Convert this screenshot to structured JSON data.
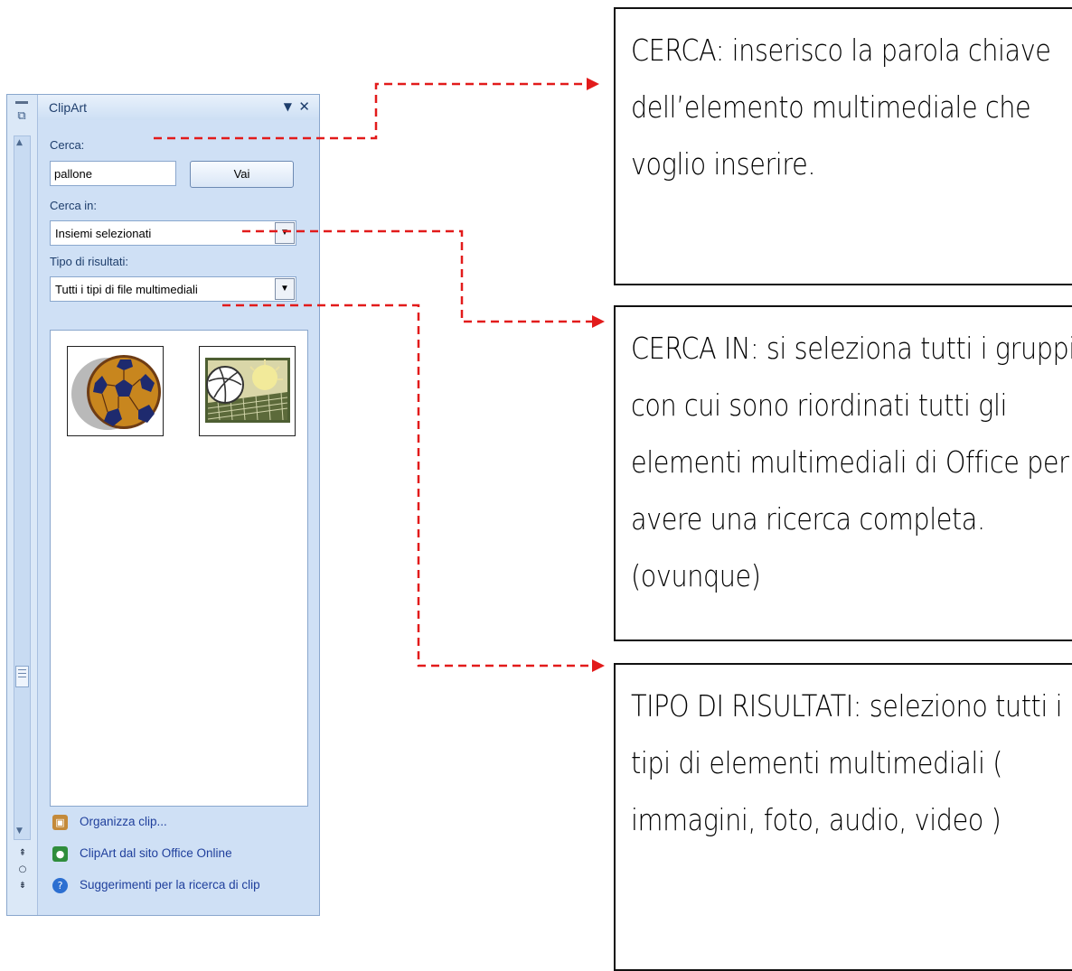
{
  "pane": {
    "title": "ClipArt",
    "search_label": "Cerca:",
    "search_value": "pallone",
    "go_button": "Vai",
    "search_in_label": "Cerca in:",
    "search_in_value": "Insiemi selezionati",
    "result_type_label": "Tipo di risultati:",
    "result_type_value": "Tutti i tipi di file multimediali",
    "results": [
      {
        "icon": "soccer-ball-clipart"
      },
      {
        "icon": "volleyball-net-clipart"
      }
    ],
    "links": [
      {
        "label": "Organizza clip...",
        "icon": "organize-clips-icon"
      },
      {
        "label": "ClipArt dal sito Office Online",
        "icon": "office-online-icon"
      },
      {
        "label": "Suggerimenti per la ricerca di clip",
        "icon": "help-icon"
      }
    ]
  },
  "callouts": [
    {
      "text": "CERCA: inserisco la parola chiave dell’elemento multimediale che voglio inserire."
    },
    {
      "text": "CERCA IN: si seleziona tutti i gruppi con cui sono riordinati tutti gli elementi multimediali di Office per avere una ricerca completa. (ovunque)"
    },
    {
      "text": "TIPO DI RISULTATI: seleziono tutti i tipi di elementi multimediali ( immagini, foto, audio, video )"
    }
  ],
  "colors": {
    "connector": "#e21b1b",
    "pane_bg": "#cfe0f5",
    "link": "#1f3f9c"
  }
}
